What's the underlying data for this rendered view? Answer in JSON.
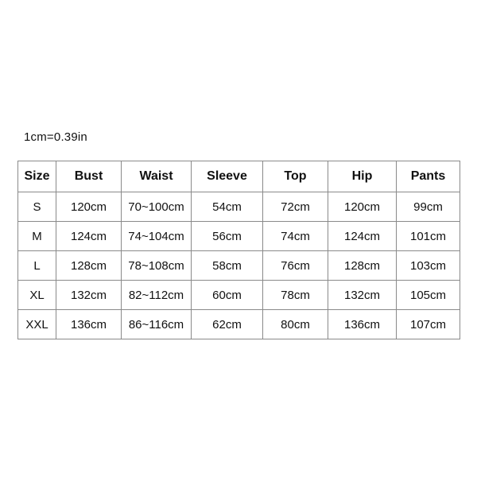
{
  "note": {
    "conversion": "1cm=0.39in"
  },
  "table": {
    "headers": [
      "Size",
      "Bust",
      "Waist",
      "Sleeve",
      "Top",
      "Hip",
      "Pants"
    ],
    "rows": [
      {
        "size": "S",
        "bust": "120cm",
        "waist": "70~100cm",
        "sleeve": "54cm",
        "top": "72cm",
        "hip": "120cm",
        "pants": "99cm"
      },
      {
        "size": "M",
        "bust": "124cm",
        "waist": "74~104cm",
        "sleeve": "56cm",
        "top": "74cm",
        "hip": "124cm",
        "pants": "101cm"
      },
      {
        "size": "L",
        "bust": "128cm",
        "waist": "78~108cm",
        "sleeve": "58cm",
        "top": "76cm",
        "hip": "128cm",
        "pants": "103cm"
      },
      {
        "size": "XL",
        "bust": "132cm",
        "waist": "82~112cm",
        "sleeve": "60cm",
        "top": "78cm",
        "hip": "132cm",
        "pants": "105cm"
      },
      {
        "size": "XXL",
        "bust": "136cm",
        "waist": "86~116cm",
        "sleeve": "62cm",
        "top": "80cm",
        "hip": "136cm",
        "pants": "107cm"
      }
    ]
  },
  "colors": {
    "background": "#ffffff",
    "text": "#111111",
    "border": "#8a8a8a"
  }
}
